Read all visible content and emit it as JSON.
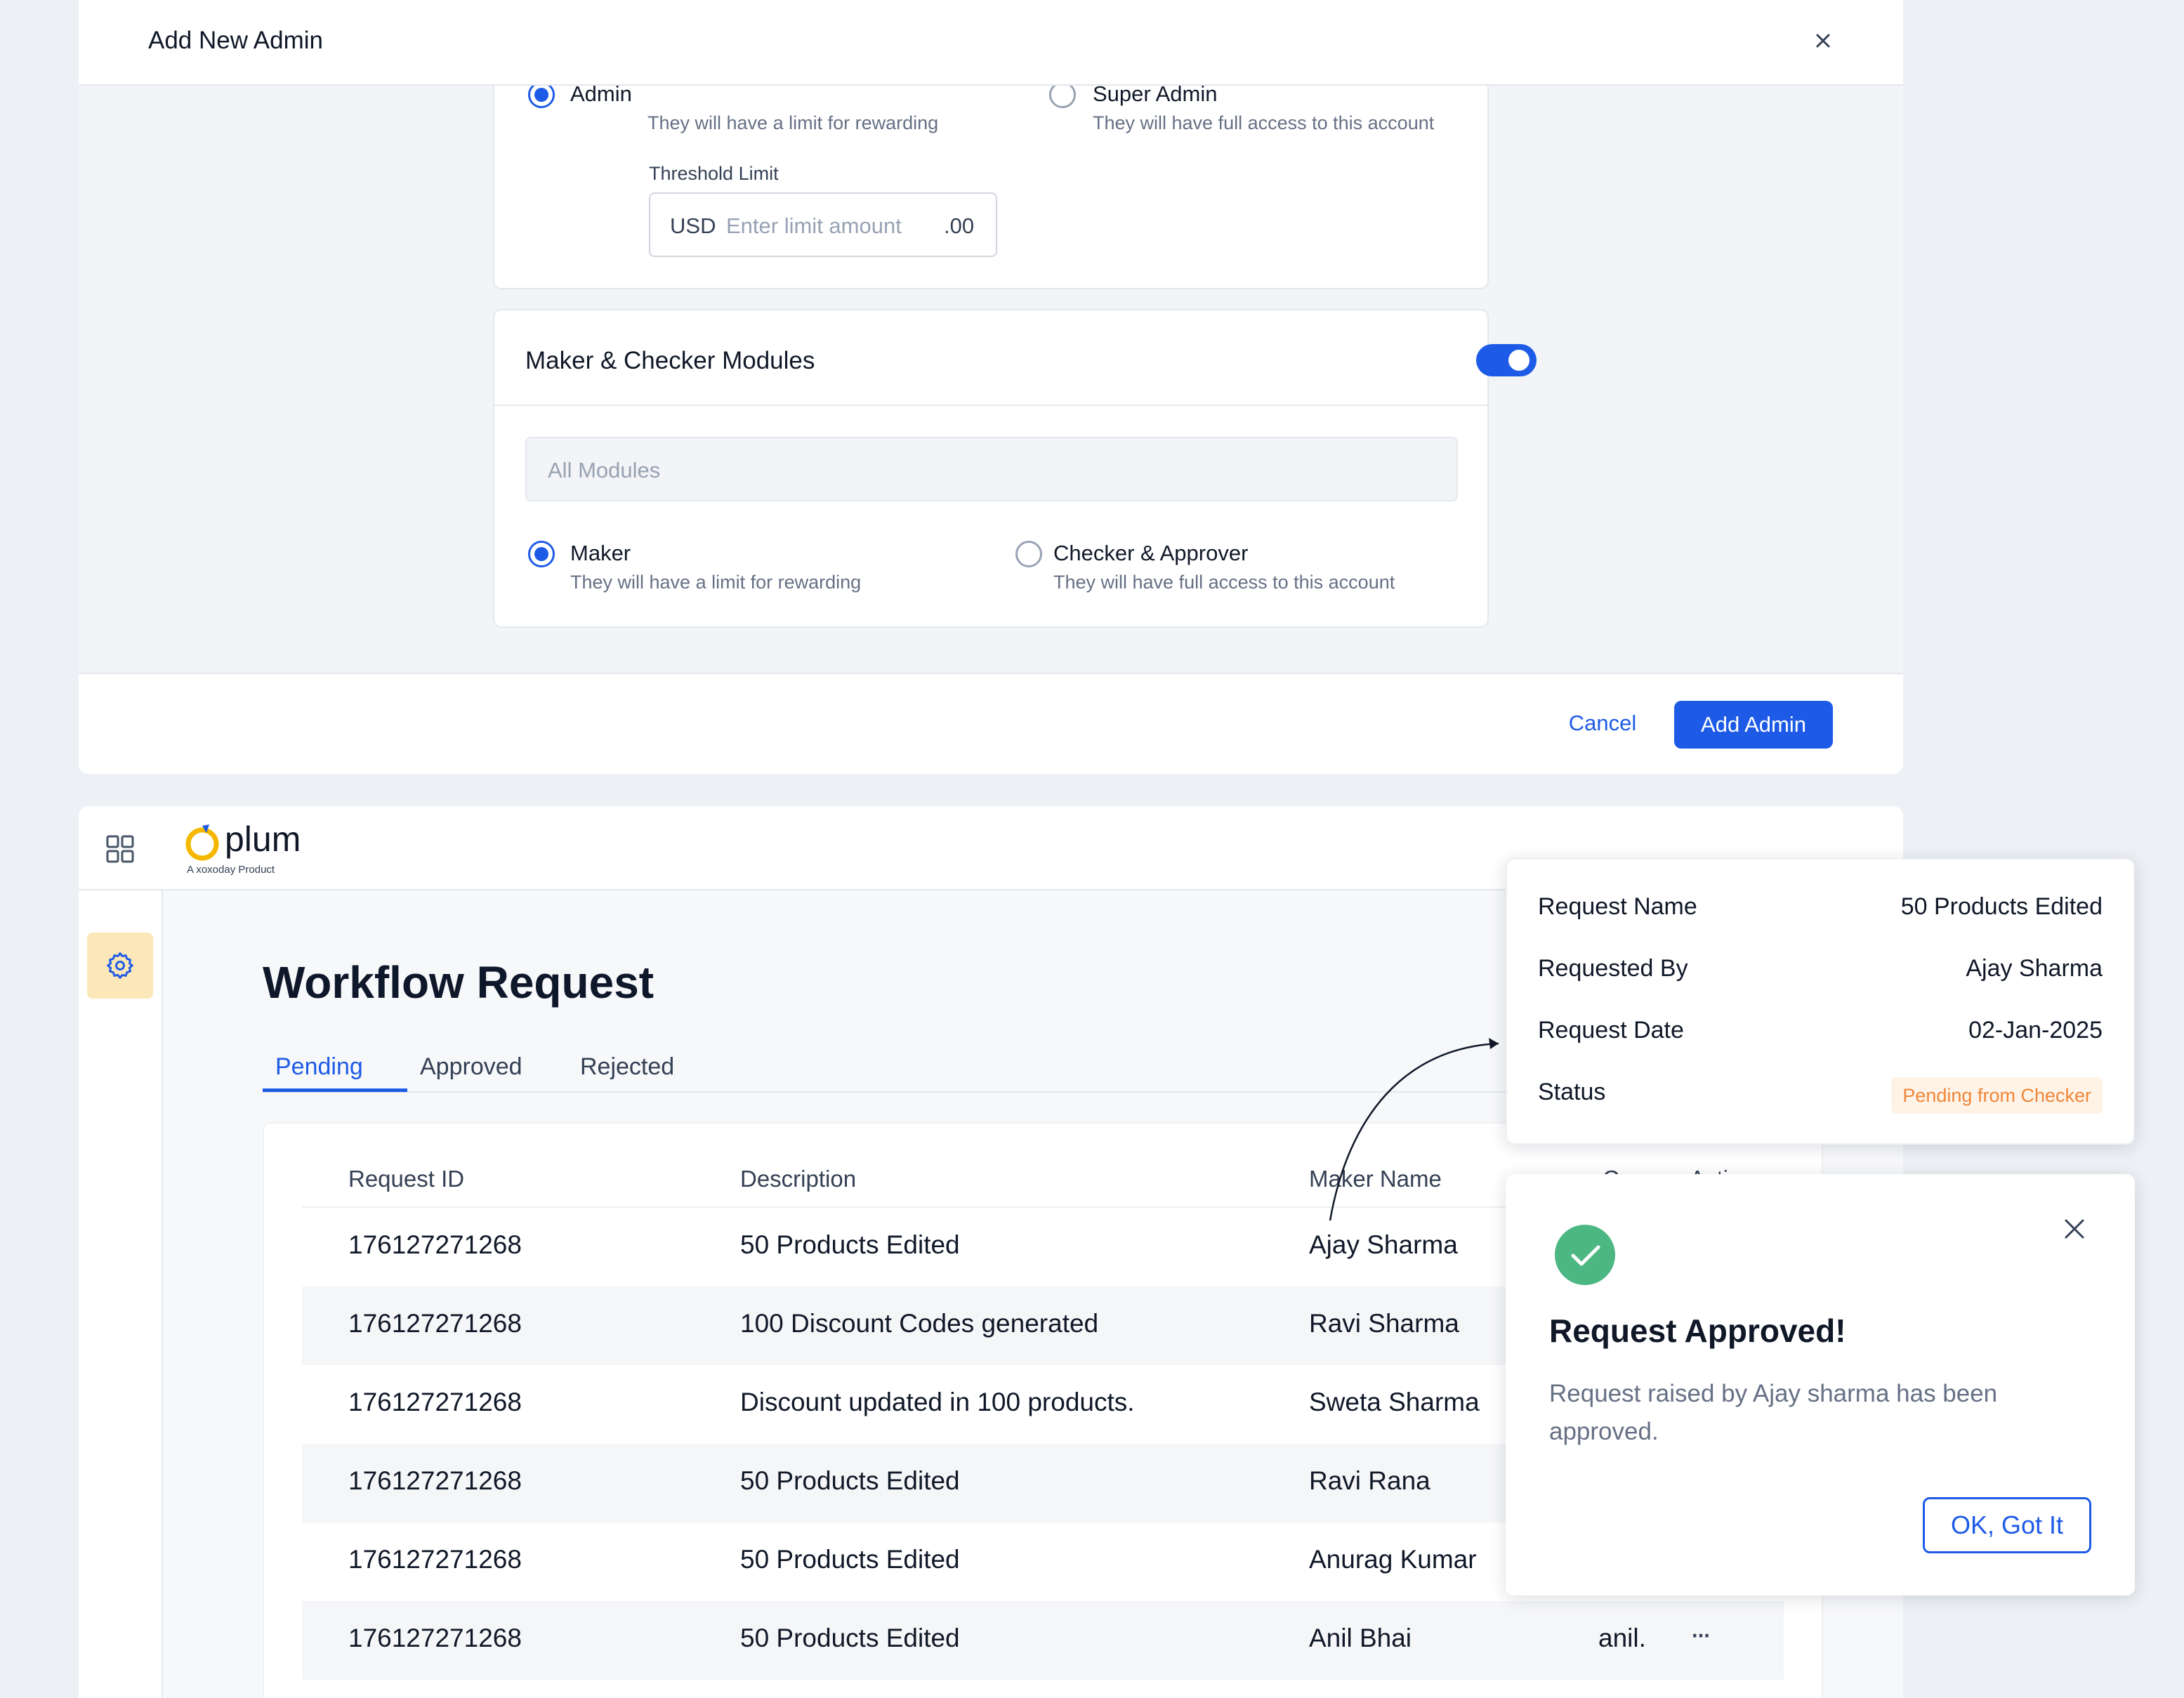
{
  "modal": {
    "title": "Add New Admin",
    "role_options": [
      {
        "label": "Admin",
        "desc": "They will have a limit for rewarding",
        "selected": true
      },
      {
        "label": "Super Admin",
        "desc": "They will have full access to this account",
        "selected": false
      }
    ],
    "threshold": {
      "label": "Threshold Limit",
      "currency": "USD",
      "placeholder": "Enter limit amount",
      "decimal": ".00"
    },
    "maker_checker": {
      "title": "Maker & Checker Modules",
      "enabled": true,
      "modules_placeholder": "All Modules",
      "options": [
        {
          "label": "Maker",
          "desc": "They will have a limit for rewarding",
          "selected": true
        },
        {
          "label": "Checker & Approver",
          "desc": "They will have full access to this account",
          "selected": false
        }
      ]
    },
    "cancel_label": "Cancel",
    "add_label": "Add Admin"
  },
  "app": {
    "logo_word": "plum",
    "logo_sub": "A xoxoday Product",
    "page_title": "Workflow Request",
    "tabs": [
      "Pending",
      "Approved",
      "Rejected"
    ],
    "active_tab": "Pending",
    "columns": [
      "Request ID",
      "Description",
      "Maker Name",
      "Crea",
      "Action"
    ],
    "rows": [
      {
        "id": "176127271268",
        "desc": "50 Products Edited",
        "maker": "Ajay Sharma",
        "creator": "",
        "action": ""
      },
      {
        "id": "176127271268",
        "desc": "100 Discount Codes generated",
        "maker": "Ravi Sharma",
        "creator": "",
        "action": ""
      },
      {
        "id": "176127271268",
        "desc": "Discount updated in 100 products.",
        "maker": "Sweta Sharma",
        "creator": "",
        "action": ""
      },
      {
        "id": "176127271268",
        "desc": "50 Products Edited",
        "maker": "Ravi Rana",
        "creator": "",
        "action": ""
      },
      {
        "id": "176127271268",
        "desc": "50 Products Edited",
        "maker": "Anurag Kumar",
        "creator": "",
        "action": ""
      },
      {
        "id": "176127271268",
        "desc": "50 Products Edited",
        "maker": "Anil Bhai",
        "creator": "anil.",
        "action": "···"
      }
    ]
  },
  "details": {
    "fields": [
      {
        "label": "Request Name",
        "value": "50 Products Edited"
      },
      {
        "label": "Requested By",
        "value": "Ajay Sharma"
      },
      {
        "label": "Request Date",
        "value": "02-Jan-2025"
      }
    ],
    "status_label": "Status",
    "status_value": "Pending from Checker"
  },
  "toast": {
    "title": "Request Approved!",
    "message": "Request raised by Ajay sharma has been approved.",
    "ok_label": "OK, Got It"
  },
  "colors": {
    "accent": "#1D5BE6",
    "success": "#4CB782",
    "pending": "#F0863A"
  }
}
